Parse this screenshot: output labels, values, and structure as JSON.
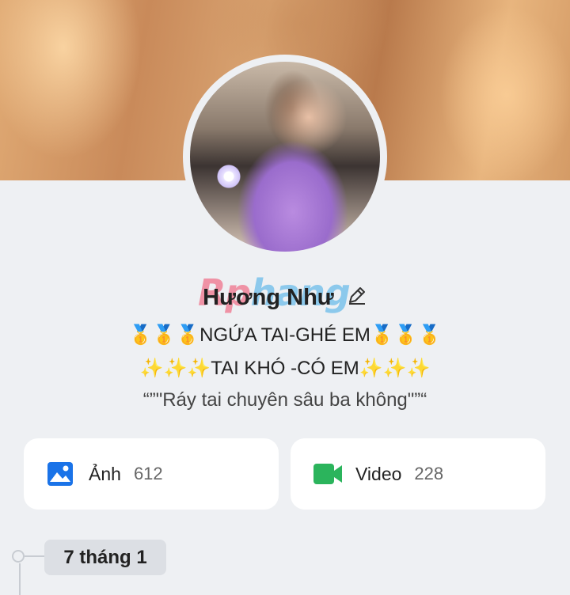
{
  "profile": {
    "name": "Hương Như",
    "bio_line1": "🥇🥇🥇NGỨA TAI-GHÉ EM🥇🥇🥇",
    "bio_line2": "✨✨✨TAI KHÓ -CÓ EM✨✨✨",
    "bio_line3": "“”\"Ráy tai chuyên sâu ba không\"”“"
  },
  "watermark": {
    "text_a": "Rp",
    "text_b": "hang"
  },
  "media": {
    "photos_label": "Ảnh",
    "photos_count": "612",
    "videos_label": "Video",
    "videos_count": "228"
  },
  "timeline": {
    "date": "7 tháng 1"
  },
  "colors": {
    "photo_icon": "#1a73e8",
    "video_icon": "#2bb45c",
    "page_bg": "#eef0f3"
  }
}
